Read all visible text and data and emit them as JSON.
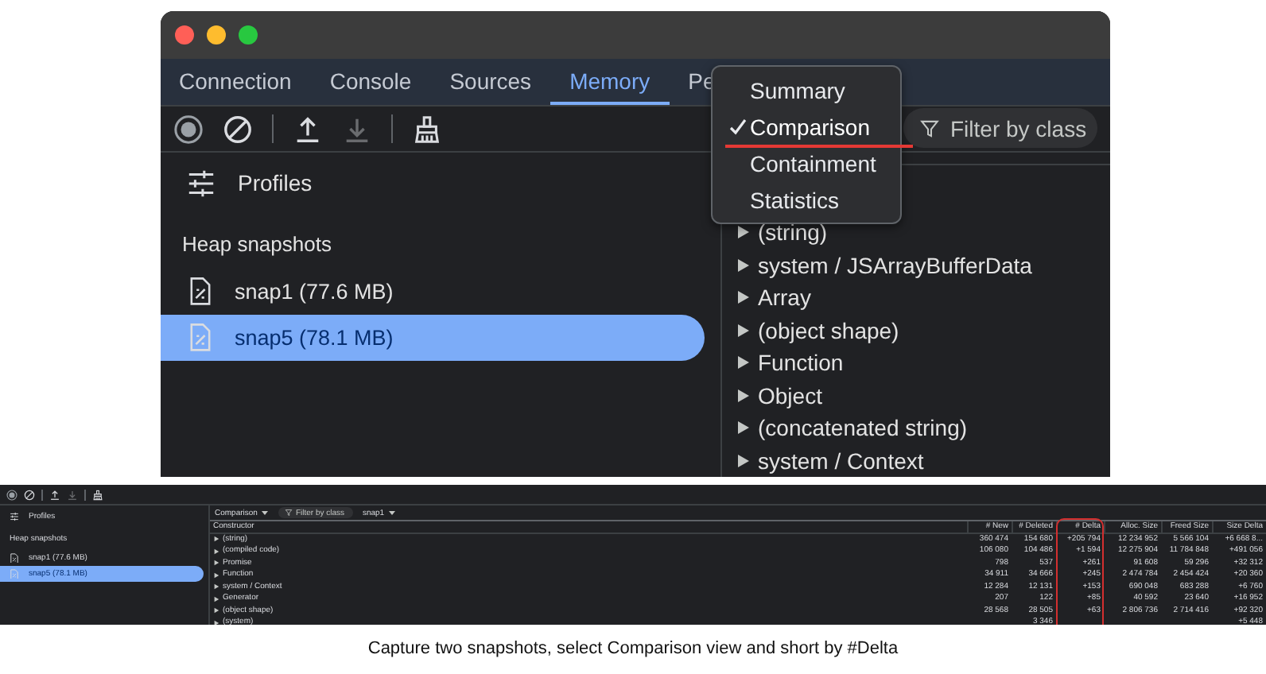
{
  "main_screenshot": {
    "tabs": [
      {
        "label": "Connection",
        "selected": false
      },
      {
        "label": "Console",
        "selected": false
      },
      {
        "label": "Sources",
        "selected": false
      },
      {
        "label": "Memory",
        "selected": true
      },
      {
        "label": "Pe",
        "selected": false
      }
    ],
    "toolbar": [
      {
        "kind": "record",
        "disabled": false
      },
      {
        "kind": "clear",
        "disabled": false
      },
      {
        "kind": "sep"
      },
      {
        "kind": "upload",
        "disabled": false
      },
      {
        "kind": "download",
        "disabled": true
      },
      {
        "kind": "sep"
      },
      {
        "kind": "collect",
        "disabled": false
      }
    ],
    "profiles_label": "Profiles",
    "section_title": "Heap snapshots",
    "snapshots": [
      {
        "label": "snap1 (77.6 MB)",
        "selected": false
      },
      {
        "label": "snap5 (78.1 MB)",
        "selected": true
      }
    ],
    "view_menu": [
      {
        "label": "Summary",
        "selected": false
      },
      {
        "label": "Comparison",
        "selected": true
      },
      {
        "label": "Containment",
        "selected": false
      },
      {
        "label": "Statistics",
        "selected": false
      }
    ],
    "filter": {
      "placeholder": "Filter by class"
    },
    "rows": [
      "(string)",
      "system / JSArrayBufferData",
      "Array",
      "(object shape)",
      "Function",
      "Object",
      "(concatenated string)",
      "system / Context"
    ]
  },
  "small_screenshot": {
    "profiles_label": "Profiles",
    "section_title": "Heap snapshots",
    "snapshots": [
      {
        "label": "snap1 (77.6 MB)",
        "selected": false
      },
      {
        "label": "snap5 (78.1 MB)",
        "selected": true
      }
    ],
    "view_select": "Comparison",
    "filter": {
      "placeholder": "Filter by class"
    },
    "base_select": "snap1",
    "columns": [
      "Constructor",
      "# New",
      "# Deleted",
      "# Delta",
      "Alloc. Size",
      "Freed Size",
      "Size Delta"
    ],
    "rows": [
      [
        "(string)",
        "360 474",
        "154 680",
        "+205 794",
        "12 234 952",
        "5 566 104",
        "+6 668 8..."
      ],
      [
        "(compiled code)",
        "106 080",
        "104 486",
        "+1 594",
        "12 275 904",
        "11 784 848",
        "+491 056"
      ],
      [
        "Promise",
        "798",
        "537",
        "+261",
        "91 608",
        "59 296",
        "+32 312"
      ],
      [
        "Function",
        "34 911",
        "34 666",
        "+245",
        "2 474 784",
        "2 454 424",
        "+20 360"
      ],
      [
        "system / Context",
        "12 284",
        "12 131",
        "+153",
        "690 048",
        "683 288",
        "+6 760"
      ],
      [
        "Generator",
        "207",
        "122",
        "+85",
        "40 592",
        "23 640",
        "+16 952"
      ],
      [
        "(object shape)",
        "28 568",
        "28 505",
        "+63",
        "2 806 736",
        "2 714 416",
        "+92 320"
      ],
      [
        "(system)",
        null,
        "3 346",
        null,
        null,
        null,
        "+5 448"
      ]
    ]
  },
  "caption": "Capture two snapshots, select Comparison view and short by #Delta"
}
